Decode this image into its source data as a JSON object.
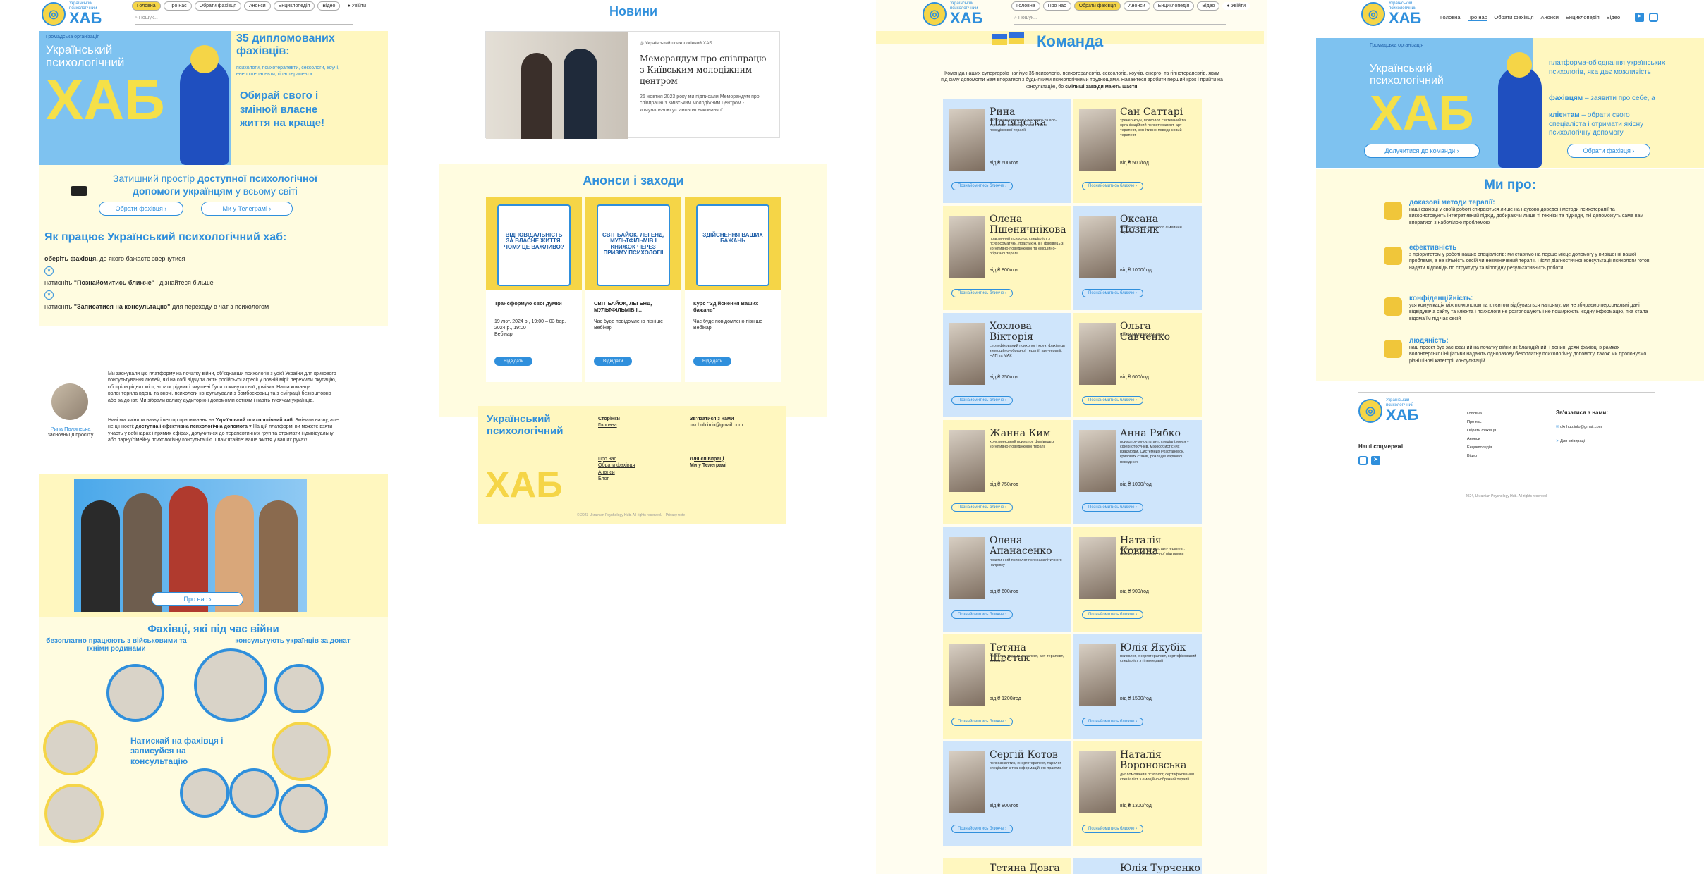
{
  "nav": {
    "home": "Головна",
    "about": "Про нас",
    "specialists": "Обрати фахівця",
    "announcements": "Анонси",
    "encyclopedia": "Енциклопедія",
    "video": "Відео",
    "login": "Увійти",
    "search_placeholder": "Пошук..."
  },
  "logo": {
    "line1": "Український",
    "line2": "психологічний",
    "word": "ХАБ"
  },
  "p1": {
    "org": "Громадська організація",
    "hero_t1": "Український",
    "hero_t2": "психологічний",
    "hero_big": "ХАБ",
    "count": "35 дипломованих фахівців:",
    "types": "психологи, психотерапевти, сексологи, коучі, енерготерапевти, гіпнотерапевти",
    "slogan": "Обирай свого і змінюй власне життя на краще!",
    "cozy1": "Затишний простір ",
    "cozy_b1": "доступної психологічної",
    "cozy_b2": "допомоги українцям",
    "cozy2": " у всьому світі",
    "btn_choose": "Обрати фахівця",
    "btn_tg": "Ми у Телеграмі",
    "how_title": "Як працює Український психологічний хаб:",
    "step1_b": "оберіть фахівця,",
    "step1": " до якого бажаєте звернутися",
    "step2_a": "натисніть ",
    "step2_b": "\"Познайомитись ближче\"",
    "step2_c": " і дізнайтеся більше",
    "step3_a": "натисніть ",
    "step3_b": "\"Записатися на консультацію\"",
    "step3_c": "  для переходу в чат з психологом",
    "founder_name": "Рина Полянська",
    "founder_role": "засновниця проєкту",
    "about1": "Ми заснували цю платформу на початку війни, об'єднавши психологів з усієї України для кризового консультування людей, які на собі відчули лють російської агресії у повній мірі: пережили окупацію, обстріли рідних міст, втрати рідних і змушені були покинути свої домівки. Наша команда волонтерила вдень та вночі, психологи консультували з бомбосховищ та з еміграції безкоштовно або за донат. Ми зібрали велику аудиторію і допомогли сотням і навіть тисячам українців.",
    "about2_a": "Нині ми змінили назву і вектор працювання на ",
    "about2_b": "Український психологічний хаб.",
    "about2_c": " Змінили назву, але не цінності: ",
    "about2_d": "доступна і ефективна психологічна допомога",
    "about2_e": " ♥ На цій платформі ви можете взяти участь у вебінарах і прямих ефірах, долучитися до терапевтичних груп та отримати індивідуальну або парну/сімейну психологічну консультацію. І пам'ятайте: ваше життя у ваших руках!",
    "btn_about": "Про нас",
    "war_title": "Фахівці, які під час війни",
    "war_left": "безоплатно працюють з військовими та їхніми родинами",
    "war_right": "консультують українців за донат",
    "war_mid": "Натискай на фахівця і записуйся на консультацію"
  },
  "p2": {
    "news_title": "Новини",
    "news_source": "Український психологічний ХАБ",
    "news_head": "Меморандум про співпрацю з Київським молодіжним центром",
    "news_text": "26 жовтня 2023 року ми підписали Меморандум про співпрацю з Київським молодіжним центром - комунальною установою виконавчої...",
    "ann_title": "Анонси і заходи",
    "ann": [
      {
        "poster": "ВІДПОВІДАЛЬНІСТЬ ЗА ВЛАСНЕ ЖИТТЯ. ЧОМУ ЦЕ ВАЖЛИВО?",
        "title": "Трансформую свої думки",
        "date": "19 лют. 2024 р., 19:00 – 03 бер. 2024 р., 19:00",
        "where": "Вебінар",
        "btn": "Відвідати"
      },
      {
        "poster": "СВІТ БАЙОК, ЛЕГЕНД, МУЛЬТФІЛЬМІВ І КНИЖОК ЧЕРЕЗ ПРИЗМУ ПСИХОЛОГІЇ",
        "title": "СВІТ БАЙОК, ЛЕГЕНД, МУЛЬТФІЛЬМІВ І...",
        "date": "Час буде повідомлено пізніше",
        "where": "Вебінар",
        "btn": "Відвідати"
      },
      {
        "poster": "ЗДІЙСНЕННЯ ВАШИХ БАЖАНЬ",
        "title": "Курс \"Здійснення Ваших бажань\"",
        "date": "Час буде повідомлено пізніше",
        "where": "Вебінар",
        "btn": "Відвідати"
      }
    ],
    "footer_big": "Український психологічний",
    "footer_hab": "ХАБ",
    "f_pages": "Сторінки",
    "f_home": "Головна",
    "f_about": "Про нас",
    "f_choose": "Обрати фахівця",
    "f_ann": "Анонси",
    "f_blog": "Блог",
    "f_contact": "Зв'язатися з нами",
    "f_email": "ukr.hub.info@gmail.com",
    "f_coop": "Для співпраці",
    "f_tg": "Ми у Телеграмі",
    "f_copy": "© 2023 Ukrainian Psychology Hub. All rights reserved.",
    "f_policy": "Privacy note"
  },
  "p3": {
    "team_title": "Команда",
    "intro_a": "Команда наших супергероїв налічує 35 психологів, психотерапевтів, сексологів, коучів, енерго- та гіпнотерапевтів, яким під силу допомогти Вам впоратися з будь-якими психологічними труднощами. Наважтеся зробити перший крок і прийти на консультацію, бо ",
    "intro_b": "смілиші завжди мають щастя.",
    "more": "Познайомитись ближче",
    "team": [
      {
        "name": "Рина Полянська",
        "desc": "засновниця проєкту, психолог та арт-терапевт, фахівець з когнітивно-поведінкової терапії",
        "price": "від ₴ 600/год"
      },
      {
        "name": "Сан Саттарі",
        "desc": "тренер-коуч, психолог, системний та організаційний психотерапевт, арт-терапевт, когнітивно-поведінковий терапевт",
        "price": "від ₴ 500/год"
      },
      {
        "name": "Олена Пшеничнікова",
        "desc": "практичний психолог, спеціаліст з психосоматики, практик НЛП, фахівець з когнітивно-поведінкової та емоційно-образної терапії",
        "price": "від ₴ 800/год"
      },
      {
        "name": "Оксана Позняк",
        "desc": "психотерапевт, сексолог, сімейний терапевт",
        "price": "від ₴ 1000/год"
      },
      {
        "name": "Хохлова Вікторія",
        "desc": "сертифікований психолог і коуч, фахівець з емоційно-образної терапії, арт-терапії, НЛП та МАК",
        "price": "від ₴ 750/год"
      },
      {
        "name": "Ольга Савченко",
        "desc": "Сімейний психолог, коуч",
        "price": "від ₴ 600/год"
      },
      {
        "name": "Жанна Ким",
        "desc": "християнський психолог, фахівець з когнітивно-поведінкової терапії",
        "price": "від ₴ 750/год"
      },
      {
        "name": "Анна Рябко",
        "desc": "психолог-консультант, спеціалізуюся у сфері стосунків, міжособистісних взаємодій, Системних Розстановок, кризових станів, розладів харчової поведінки",
        "price": "від ₴ 1000/год"
      },
      {
        "name": "Олена Апанасенко",
        "desc": "практичний психолог психоаналітичного напряму",
        "price": "від ₴ 600/год"
      },
      {
        "name": "Наталія Ковина",
        "desc": "психолог-консультант, арт-терапевт, фахівець з психологічної підтримки",
        "price": "від ₴ 900/год"
      },
      {
        "name": "Тетяна Шестак",
        "desc": "психолог, травма-терапевт, арт-терапевт, сексолог",
        "price": "від ₴ 1200/год"
      },
      {
        "name": "Юлія Якубік",
        "desc": "психолог, енерготерапевт, сертифікований спеціаліст з гіпнотерапії",
        "price": "від ₴ 1500/год"
      },
      {
        "name": "Сергій Котов",
        "desc": "психоаналітик, енерготерапевт, таролог, спеціаліст з трансформаційних практик",
        "price": "від ₴ 800/год"
      },
      {
        "name": "Наталія Вороновська",
        "desc": "дипломований психолог, сертифікований спеціаліст з емоційно-образної терапії",
        "price": "від ₴ 1300/год"
      }
    ],
    "tail_left": "Тетяна Довга",
    "tail_right": "Юлія Турченко"
  },
  "p4": {
    "org": "Громадська організація",
    "hero_t1": "Український",
    "hero_t2": "психологічний",
    "hero_big": "ХАБ",
    "right1": "платформа-об'єднання українських психологів, яка дає можливість",
    "right2_b": "фахівцям",
    "right2": " – заявити про себе, а",
    "right3_b": "клієнтам",
    "right3": " – обрати свого спеціаліста і отримати якісну психологічну допомогу",
    "btn_join": "Долучитися до команди",
    "btn_choose": "Обрати фахівця",
    "we_title": "Ми про:",
    "items": [
      {
        "t": "доказові методи терапії:",
        "d": "наші фахівці у своїй роботі спираються лише на науково доведені методи психотерапії та використовують інтегративний підхід, добираючи лише ті техніки та підходи, які допоможуть саме вам впоратися з наболілою проблемою"
      },
      {
        "t": "ефективність",
        "d": "з пріоритетом у роботі наших спеціалістів: ми ставимо на перше місце допомогу у вирішенні вашої проблеми, а не кількість сесій чи невизначений терапії. Після діагностичної консультації психологи готові надати відповідь по структуру та вірогідну результативність роботи"
      },
      {
        "t": "конфіденційність:",
        "d": "уся комунікація між психологом та клієнтом відбувається напряму, ми не збираємо персональні дані відвідувача сайту та клієнта і психологи не розголошують і не поширюють жодну інформацію, яка стала відома їм під час сесій"
      },
      {
        "t": "людяність:",
        "d": "наш проєкт був заснований на початку війни як благодійний, і донині деякі фахівці в рамках волонтерської ініціативи надають одноразову безоплатну психологічну допомогу, також ми пропонуємо різні цінові категорії консультацій"
      }
    ],
    "f_home": "Головна",
    "f_about": "Про нас",
    "f_choose": "Обрати фахівця",
    "f_ann": "Анонси",
    "f_enc": "Енциклопедія",
    "f_video": "Відео",
    "f_contact": "Зв'язатися з нами:",
    "f_email": "ukr.hub.info@gmail.com",
    "f_coop": "Для співпраці",
    "f_social": "Наші соцмережі",
    "f_copy": "2024, Ukrainian Psychology Hub. All rights reserved."
  }
}
